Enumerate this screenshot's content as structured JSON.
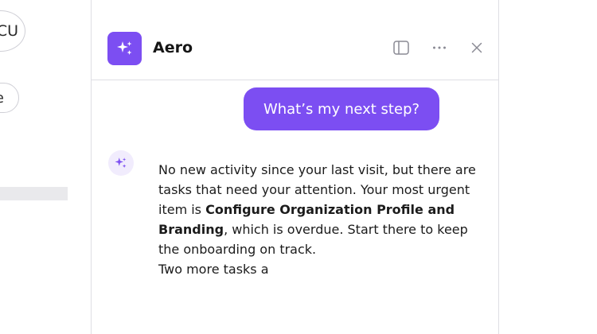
{
  "background": {
    "avatar_initials": "CU",
    "pill_label": "e"
  },
  "header": {
    "title": "Aero",
    "icons": {
      "logo": "sparkles-icon",
      "sidebar_toggle": "sidebar-toggle-icon",
      "more": "more-horizontal-icon",
      "close": "close-icon"
    }
  },
  "conversation": {
    "user_message": "What’s my next step?",
    "assistant_reply": {
      "part1": "No new activity since your last visit, but there are tasks that need your attention. Your most urgent item is ",
      "bold": "Configure Organization Profile and Branding",
      "part2": ", which is overdue. Start there to keep the onboarding on track.",
      "line2": "Two more tasks a"
    }
  },
  "colors": {
    "accent": "#7c4ef2",
    "avatar_bg": "#f1ecfd",
    "border": "#dedee4"
  }
}
